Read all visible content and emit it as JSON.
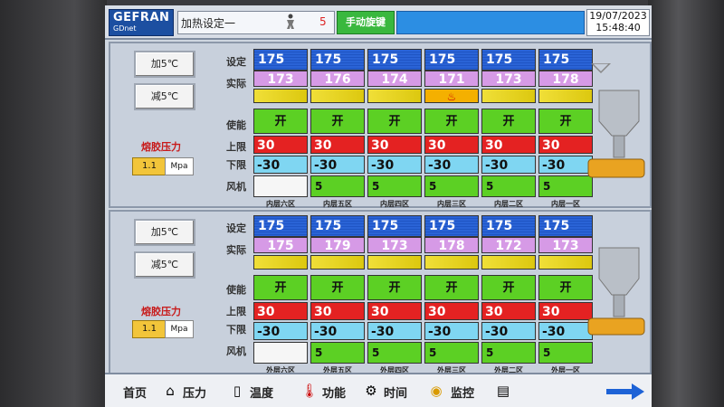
{
  "header": {
    "logo_top": "GEFRAN",
    "logo_bottom": "GDnet",
    "title": "加热设定一",
    "number": "5",
    "mode_label": "手动旋键",
    "date": "19/07/2023",
    "time": "15:48:40"
  },
  "row_labels": {
    "set": "设定",
    "actual": "实际",
    "enable": "使能",
    "upper": "上限",
    "lower": "下限",
    "fan": "风机"
  },
  "panels": [
    {
      "add_label": "加5℃",
      "sub_label": "减5℃",
      "pressure_label": "熔胶压力",
      "pressure_value": "1.1",
      "pressure_unit": "Mpa",
      "zones": [
        {
          "name": "内层六区",
          "set": "175",
          "actual": "173",
          "heating": "",
          "enable": "开",
          "upper": "30",
          "lower": "-30",
          "fan": "",
          "fan_on": false
        },
        {
          "name": "内层五区",
          "set": "175",
          "actual": "176",
          "heating": "",
          "enable": "开",
          "upper": "30",
          "lower": "-30",
          "fan": "5",
          "fan_on": true
        },
        {
          "name": "内层四区",
          "set": "175",
          "actual": "174",
          "heating": "",
          "enable": "开",
          "upper": "30",
          "lower": "-30",
          "fan": "5",
          "fan_on": true
        },
        {
          "name": "内层三区",
          "set": "175",
          "actual": "171",
          "heating": "heater-icon",
          "enable": "开",
          "upper": "30",
          "lower": "-30",
          "fan": "5",
          "fan_on": true
        },
        {
          "name": "内层二区",
          "set": "175",
          "actual": "173",
          "heating": "",
          "enable": "开",
          "upper": "30",
          "lower": "-30",
          "fan": "5",
          "fan_on": true
        },
        {
          "name": "内层一区",
          "set": "175",
          "actual": "178",
          "heating": "",
          "enable": "开",
          "upper": "30",
          "lower": "-30",
          "fan": "5",
          "fan_on": true
        }
      ]
    },
    {
      "add_label": "加5℃",
      "sub_label": "减5℃",
      "pressure_label": "熔胶压力",
      "pressure_value": "1.1",
      "pressure_unit": "Mpa",
      "zones": [
        {
          "name": "外层六区",
          "set": "175",
          "actual": "175",
          "heating": "",
          "enable": "开",
          "upper": "30",
          "lower": "-30",
          "fan": "",
          "fan_on": false
        },
        {
          "name": "外层五区",
          "set": "175",
          "actual": "179",
          "heating": "",
          "enable": "开",
          "upper": "30",
          "lower": "-30",
          "fan": "5",
          "fan_on": true
        },
        {
          "name": "外层四区",
          "set": "175",
          "actual": "173",
          "heating": "",
          "enable": "开",
          "upper": "30",
          "lower": "-30",
          "fan": "5",
          "fan_on": true
        },
        {
          "name": "外层三区",
          "set": "175",
          "actual": "178",
          "heating": "",
          "enable": "开",
          "upper": "30",
          "lower": "-30",
          "fan": "5",
          "fan_on": true
        },
        {
          "name": "外层二区",
          "set": "175",
          "actual": "172",
          "heating": "",
          "enable": "开",
          "upper": "30",
          "lower": "-30",
          "fan": "5",
          "fan_on": true
        },
        {
          "name": "外层一区",
          "set": "175",
          "actual": "173",
          "heating": "",
          "enable": "开",
          "upper": "30",
          "lower": "-30",
          "fan": "5",
          "fan_on": true
        }
      ]
    }
  ],
  "footer": {
    "home": "首页",
    "pressure": "压力",
    "temperature": "温度",
    "function": "功能",
    "time": "时间",
    "monitor": "监控"
  },
  "colors": {
    "set": "#2a63d6",
    "actual": "#d69ae6",
    "upper": "#e42222",
    "lower": "#7fd6f2",
    "enable": "#5cd024",
    "accent_mode": "#39b83e"
  }
}
